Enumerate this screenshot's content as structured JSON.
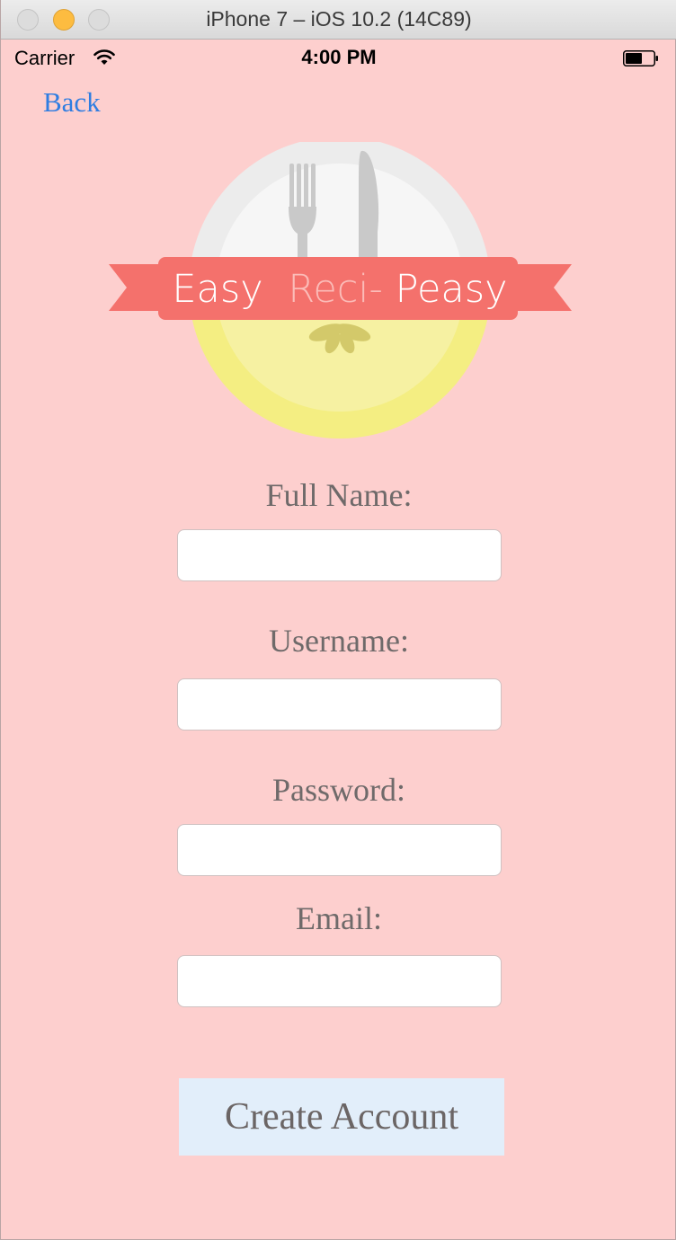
{
  "window": {
    "title": "iPhone 7 – iOS 10.2 (14C89)"
  },
  "status_bar": {
    "carrier": "Carrier",
    "time": "4:00 PM"
  },
  "nav": {
    "back_label": "Back"
  },
  "logo": {
    "word1": "Easy",
    "word2": "Reci-",
    "word3": "Peasy"
  },
  "form": {
    "full_name": {
      "label": "Full Name:",
      "value": "",
      "placeholder": ""
    },
    "username": {
      "label": "Username:",
      "value": "",
      "placeholder": ""
    },
    "password": {
      "label": "Password:",
      "value": "",
      "placeholder": ""
    },
    "email": {
      "label": "Email:",
      "value": "",
      "placeholder": ""
    }
  },
  "actions": {
    "create_label": "Create Account"
  },
  "colors": {
    "background": "#fdcfce",
    "link": "#2f7de1",
    "banner": "#f4716c",
    "button_bg": "#e2eefa",
    "label_text": "#6f6a6a"
  }
}
